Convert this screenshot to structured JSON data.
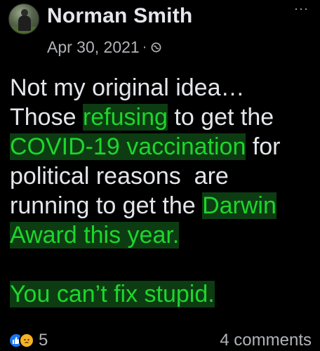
{
  "post": {
    "author": "Norman Smith",
    "date": "Apr 30, 2021",
    "dot": "·",
    "more": "···",
    "lines": [
      [
        "Not my original idea…"
      ],
      [
        "Those ",
        "refusing",
        " to get the"
      ],
      [
        "COVID-19 vaccination",
        " for"
      ],
      [
        "political reasons  are"
      ],
      [
        "running to get the ",
        "Darwin"
      ],
      [
        "Award this year."
      ],
      [],
      [
        "You can’t fix stupid."
      ]
    ]
  },
  "body": {
    "line1": "Not my original idea…",
    "line2a": "Those ",
    "line2b": "refusing",
    "line2c": " to get the",
    "line3a": "COVID-19 vaccination",
    "line3b": " for",
    "line4": "political reasons  are",
    "line5a": "running to get the ",
    "line5b": "Darwin",
    "line6": "Award this year.",
    "line8": "You can’t fix stupid."
  },
  "footer": {
    "reaction_count": "5",
    "comments": "4 comments"
  },
  "colors": {
    "highlight_text": "#1dd62c",
    "highlight_bg": "#0d3c12",
    "like": "#1877f2",
    "sad": "#f7b125"
  },
  "icons": {
    "privacy": "globe-icon",
    "reactions": [
      "like-icon",
      "sad-icon"
    ],
    "menu": "more-options-icon"
  }
}
